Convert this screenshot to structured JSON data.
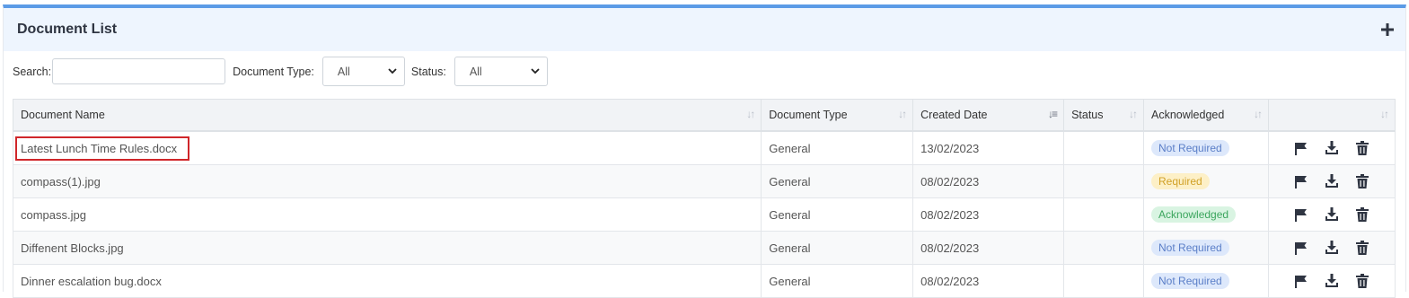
{
  "panel": {
    "title": "Document List"
  },
  "filters": {
    "search_label": "Search:",
    "search_value": "",
    "doctype_label": "Document Type:",
    "doctype_value": "All",
    "status_label": "Status:",
    "status_value": "All"
  },
  "table": {
    "headers": [
      "Document Name",
      "Document Type",
      "Created Date",
      "Status",
      "Acknowledged",
      ""
    ],
    "rows": [
      {
        "name": "Latest Lunch Time Rules.docx",
        "type": "General",
        "date": "13/02/2023",
        "status": "",
        "ack": "Not Required"
      },
      {
        "name": "compass(1).jpg",
        "type": "General",
        "date": "08/02/2023",
        "status": "",
        "ack": "Required"
      },
      {
        "name": "compass.jpg",
        "type": "General",
        "date": "08/02/2023",
        "status": "",
        "ack": "Acknowledged"
      },
      {
        "name": "Diffenent Blocks.jpg",
        "type": "General",
        "date": "08/02/2023",
        "status": "",
        "ack": "Not Required"
      },
      {
        "name": "Dinner escalation bug.docx",
        "type": "General",
        "date": "08/02/2023",
        "status": "",
        "ack": "Not Required"
      }
    ]
  },
  "colors": {
    "accent": "#5b9be6",
    "header_bg": "#eef5fe",
    "highlight": "#d0262a"
  },
  "icons": [
    "plus-icon",
    "chevron-down-icon",
    "sort-icon",
    "flag-icon",
    "download-icon",
    "trash-icon"
  ]
}
